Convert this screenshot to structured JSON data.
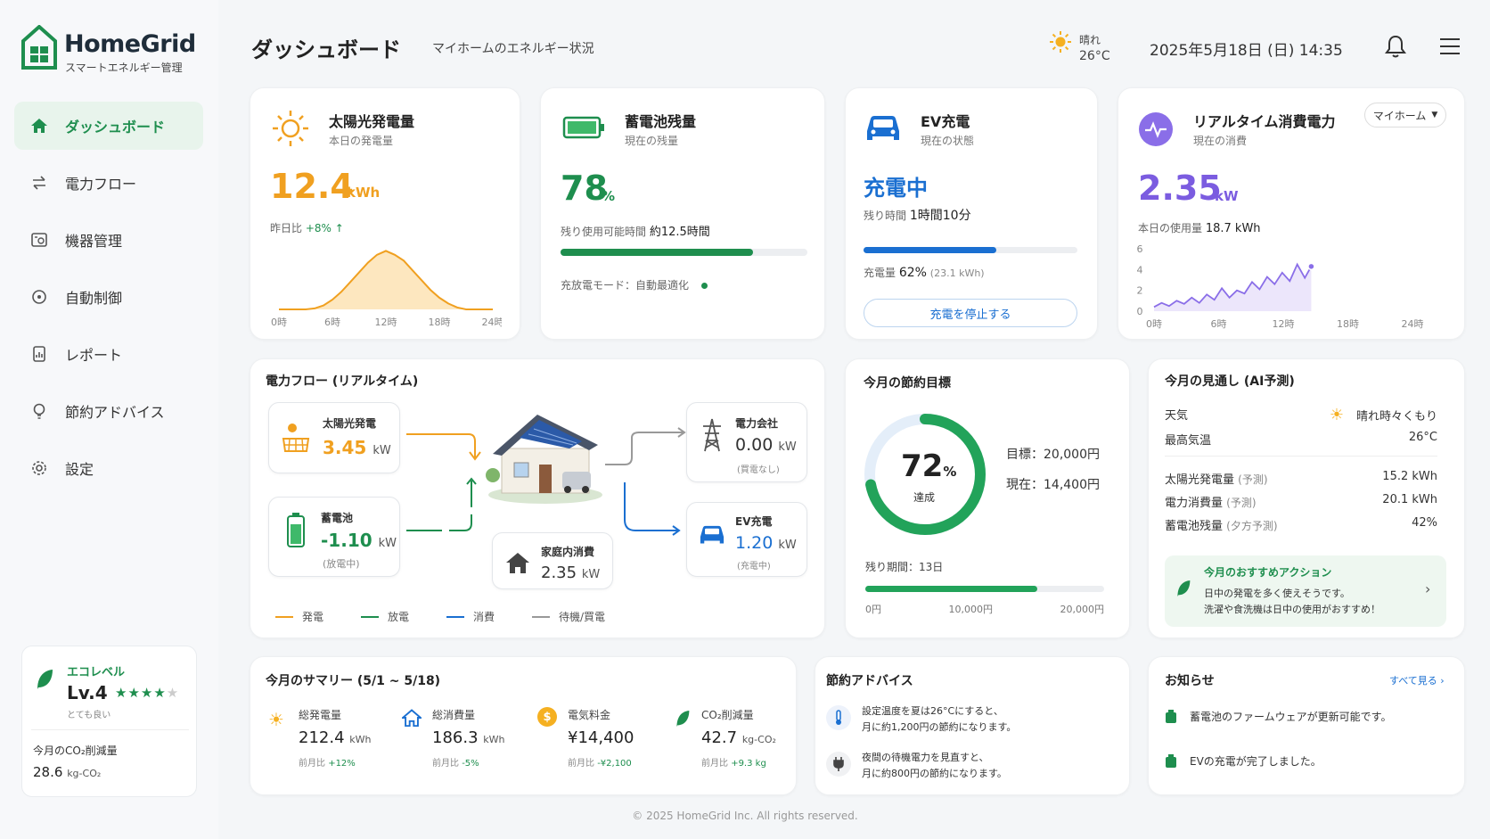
{
  "app": {
    "name": "HomeGrid",
    "subtitle": "スマートエネルギー管理"
  },
  "nav": [
    {
      "label": "ダッシュボード",
      "icon": "home-icon"
    },
    {
      "label": "電力フロー",
      "icon": "flow-icon"
    },
    {
      "label": "機器管理",
      "icon": "device-icon"
    },
    {
      "label": "自動制御",
      "icon": "auto-control-icon"
    },
    {
      "label": "レポート",
      "icon": "report-icon"
    },
    {
      "label": "節約アドバイス",
      "icon": "bulb-icon"
    },
    {
      "label": "設定",
      "icon": "gear-icon"
    }
  ],
  "eco": {
    "title": "エコレベル",
    "level": "Lv.4",
    "rating": 4,
    "rating_text": "とても良い",
    "co2_label": "今月のCO₂削減量",
    "co2_value": "28.6",
    "co2_unit": "kg-CO₂"
  },
  "header": {
    "title": "ダッシュボード",
    "subtitle": "マイホームのエネルギー状況",
    "weather": "晴れ",
    "temp": "26°C",
    "datetime": "2025年5月18日 (日) 14:35"
  },
  "solar": {
    "title": "太陽光発電量",
    "sub": "本日の発電量",
    "value": "12.4",
    "unit": "kWh",
    "cmp_label": "昨日比",
    "cmp_value": "+8%",
    "ticks": [
      "0時",
      "6時",
      "12時",
      "18時",
      "24時"
    ]
  },
  "battery": {
    "title": "蓄電池残量",
    "sub": "現在の残量",
    "value": "78",
    "unit": "%",
    "remain_label": "残り使用可能時間",
    "remain_value": "約12.5時間",
    "level": 0.78,
    "mode_text": "充放電モード：自動最適化"
  },
  "ev": {
    "title": "EV充電",
    "sub": "現在の状態",
    "status": "充電中",
    "remain_label": "残り時間",
    "remain_value": "1時間10分",
    "charge_label": "充電量",
    "charge_pct": "62%",
    "charge_kwh": "(23.1 kWh)",
    "level": 0.62,
    "button": "充電を停止する"
  },
  "realtime": {
    "title": "リアルタイム消費電力",
    "sub": "現在の消費",
    "select": "マイホーム",
    "value": "2.35",
    "unit": "kW",
    "today_label": "本日の使用量",
    "today_value": "18.7 kWh",
    "yticks": [
      "6",
      "4",
      "2",
      "0"
    ],
    "xticks": [
      "0時",
      "6時",
      "12時",
      "18時",
      "24時"
    ]
  },
  "chart_data": {
    "type": "line",
    "x": [
      0,
      1,
      2,
      3,
      4,
      5,
      6,
      7,
      8,
      9,
      10,
      11,
      12,
      13,
      14,
      15,
      16,
      17,
      18,
      19,
      20,
      21,
      22,
      23,
      24
    ],
    "series": [],
    "xlabel": "",
    "ylabel": "",
    "solar_curve": [
      0,
      0,
      0,
      0,
      0.05,
      0.2,
      0.5,
      0.9,
      1.4,
      1.9,
      2.4,
      2.8,
      3.0,
      2.8,
      2.5,
      2.0,
      1.5,
      1.0,
      0.6,
      0.3,
      0.1,
      0,
      0,
      0,
      0
    ],
    "usage_times": [
      0,
      0.7,
      1.4,
      2.1,
      2.8,
      3.5,
      4.2,
      4.9,
      5.6,
      6.3,
      7.0,
      7.7,
      8.4,
      9.1,
      9.8,
      10.5,
      11.2,
      11.9,
      12.6,
      13.3,
      14.0,
      14.6
    ],
    "usage_values": [
      0.4,
      0.8,
      0.5,
      1.0,
      0.7,
      1.3,
      0.8,
      1.6,
      1.1,
      2.2,
      1.3,
      2.0,
      1.7,
      2.8,
      2.1,
      3.3,
      2.6,
      3.7,
      2.9,
      4.5,
      3.2,
      4.3
    ],
    "usage_ylim": [
      0,
      6
    ]
  },
  "flow": {
    "title": "電力フロー (リアルタイム)",
    "solar": {
      "label": "太陽光発電",
      "value": "3.45",
      "unit": "kW"
    },
    "battery": {
      "label": "蓄電池",
      "value": "-1.10",
      "unit": "kW",
      "note": "(放電中)"
    },
    "house": {
      "label": "家庭内消費",
      "value": "2.35",
      "unit": "kW"
    },
    "grid": {
      "label": "電力会社",
      "value": "0.00",
      "unit": "kW",
      "note": "(買電なし)"
    },
    "ev": {
      "label": "EV充電",
      "value": "1.20",
      "unit": "kW",
      "note": "(充電中)"
    },
    "legend": [
      "発電",
      "放電",
      "消費",
      "待機/買電"
    ]
  },
  "goal": {
    "title": "今月の節約目標",
    "pct": "72",
    "pct_unit": "%",
    "pct_label": "達成",
    "ratio": 0.72,
    "target_label": "目標：20,000円",
    "current_label": "現在：14,400円",
    "remain": "残り期間：13日",
    "ticks": [
      "0円",
      "10,000円",
      "20,000円"
    ]
  },
  "forecast": {
    "title": "今月の見通し (AI予測)",
    "rows1": [
      {
        "label": "天気",
        "value": "晴れ時々くもり"
      },
      {
        "label": "最高気温",
        "value": "26°C"
      }
    ],
    "rows2": [
      {
        "label": "太陽光発電量",
        "note": "(予測)",
        "value": "15.2 kWh"
      },
      {
        "label": "電力消費量",
        "note": "(予測)",
        "value": "20.1 kWh"
      },
      {
        "label": "蓄電池残量",
        "note": "(夕方予測)",
        "value": "42%"
      }
    ],
    "action_title": "今月のおすすめアクション",
    "action_line1": "日中の発電を多く使えそうです。",
    "action_line2": "洗濯や食洗機は日中の使用がおすすめ！"
  },
  "summary": {
    "title": "今月のサマリー (5/1 ~ 5/18)",
    "items": [
      {
        "label": "総発電量",
        "value": "212.4",
        "unit": "kWh",
        "cmp_label": "前月比",
        "cmp": "+12%",
        "icon": "sun-icon"
      },
      {
        "label": "総消費量",
        "value": "186.3",
        "unit": "kWh",
        "cmp_label": "前月比",
        "cmp": "-5%",
        "icon": "house-icon"
      },
      {
        "label": "電気料金",
        "value": "¥14,400",
        "unit": "",
        "cmp_label": "前月比",
        "cmp": "-¥2,100",
        "icon": "coin-icon"
      },
      {
        "label": "CO₂削減量",
        "value": "42.7",
        "unit": "kg-CO₂",
        "cmp_label": "前月比",
        "cmp": "+9.3 kg",
        "icon": "leaf-icon"
      }
    ]
  },
  "advice": {
    "title": "節約アドバイス",
    "items": [
      {
        "line1": "設定温度を夏は26°Cにすると、",
        "line2": "月に約1,200円の節約になります。"
      },
      {
        "line1": "夜間の待機電力を見直すと、",
        "line2": "月に約800円の節約になります。"
      }
    ]
  },
  "news": {
    "title": "お知らせ",
    "link": "すべて見る",
    "items": [
      "蓄電池のファームウェアが更新可能です。",
      "EVの充電が完了しました。"
    ]
  },
  "footer": "© 2025 HomeGrid Inc. All rights reserved.",
  "colors": {
    "green": "#1e8e4e",
    "orange": "#f0a020",
    "blue": "#1a6fd1",
    "purple": "#7b5ce0"
  }
}
